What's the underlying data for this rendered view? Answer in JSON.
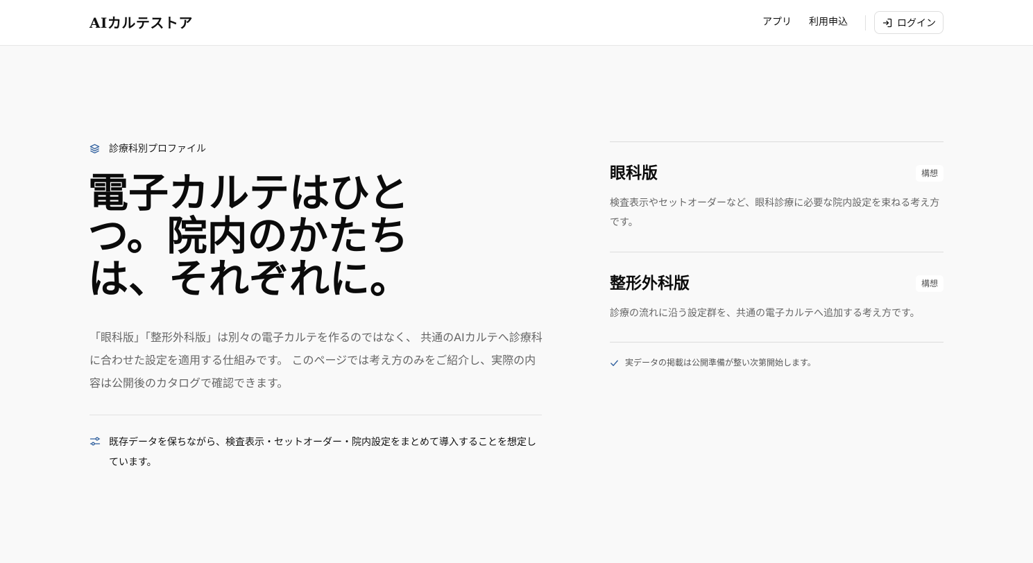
{
  "header": {
    "brand": "AIカルテストア",
    "nav": [
      {
        "label": "アプリ"
      },
      {
        "label": "利用申込"
      }
    ],
    "login_label": "ログイン"
  },
  "hero": {
    "eyebrow": "診療科別プロファイル",
    "title_lines": [
      "電子カルテはひと",
      "つ。院内のかたち",
      "は、それぞれに。"
    ],
    "description": "「眼科版」「整形外科版」は別々の電子カルテを作るのではなく、 共通のAIカルテへ診療科に合わせた設定を適用する仕組みです。 このページでは考え方のみをご紹介し、実際の内容は公開後のカタログで確認できます。",
    "note": "既存データを保ちながら、検査表示・セットオーダー・院内設定をまとめて導入することを想定しています。"
  },
  "profiles": [
    {
      "title": "眼科版",
      "badge": "構想",
      "description": "検査表示やセットオーダーなど、眼科診療に必要な院内設定を束ねる考え方です。"
    },
    {
      "title": "整形外科版",
      "badge": "構想",
      "description": "診療の流れに沿う設定群を、共通の電子カルテへ追加する考え方です。"
    }
  ],
  "footnote": "実データの掲載は公開準備が整い次第開始します。",
  "colors": {
    "accent": "#2f5f9e",
    "background": "#f9f9f9",
    "muted_text": "#666666"
  },
  "icons": {
    "login": "login-arrow-icon",
    "eyebrow": "layers-icon",
    "note": "sliders-icon",
    "footnote": "check-icon"
  }
}
